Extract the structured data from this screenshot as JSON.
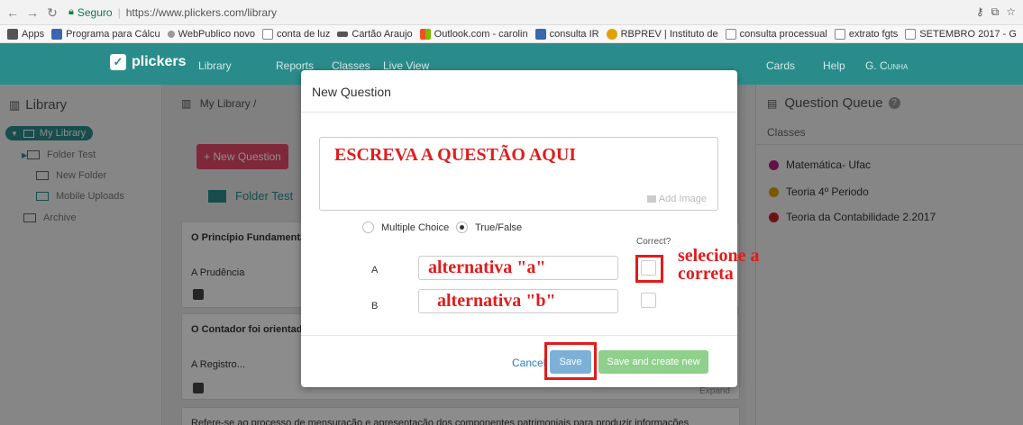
{
  "browser": {
    "secure_label": "Seguro",
    "url": "https://www.plickers.com/library",
    "bookmarks": [
      {
        "label": "Apps",
        "color": "#555555"
      },
      {
        "label": "Programa para Cálcu",
        "color": "#3a66b0"
      },
      {
        "label": "WebPublico novo",
        "color": "#999999"
      },
      {
        "label": "conta de luz",
        "color": "#888888"
      },
      {
        "label": "Cartão Araujo",
        "color": "#555555"
      },
      {
        "label": "Outlook.com - carolin",
        "color": "#f25022"
      },
      {
        "label": "consulta IR",
        "color": "#3a66b0"
      },
      {
        "label": "RBPREV | Instituto de",
        "color": "#e0a100"
      },
      {
        "label": "consulta processual",
        "color": "#888888"
      },
      {
        "label": "extrato fgts",
        "color": "#888888"
      },
      {
        "label": "SETEMBRO 2017 - G",
        "color": "#888888"
      }
    ]
  },
  "app": {
    "logo": "plickers",
    "nav": [
      "Library",
      "Reports",
      "Classes",
      "Live View"
    ],
    "nav_right": [
      "Cards",
      "Help",
      "G. Cunha"
    ]
  },
  "sidebar": {
    "title": "Library",
    "my_library": "My Library",
    "items": [
      "Folder Test",
      "New Folder",
      "Mobile Uploads",
      "Archive"
    ]
  },
  "center": {
    "breadcrumb": "My Library  /",
    "new_question": "+ New Question",
    "folder": "Folder Test",
    "cards": [
      {
        "title": "O Princípio Fundamenta autonomia patrimonial, e",
        "answer": "A  Prudência"
      },
      {
        "title": "O Contador foi orientado linearmente de um ativo",
        "answer": "A  Registro...",
        "expand": "Expand"
      }
    ],
    "footer_text": "Refere-se ao processo de mensuração e apresentação dos componentes patrimoniais para produzir informações"
  },
  "right": {
    "title": "Question Queue",
    "classes_label": "Classes",
    "classes": [
      {
        "name": "Matemática- Ufac",
        "color": "#b2227d"
      },
      {
        "name": "Teoria 4º Periodo",
        "color": "#e0a100"
      },
      {
        "name": "Teoria da Contabilidade 2.2017",
        "color": "#c9201f"
      }
    ]
  },
  "modal": {
    "title": "New Question",
    "question_text": "ESCREVA A QUESTÃO AQUI",
    "add_image": "Add Image",
    "type_options": [
      "Multiple Choice",
      "True/False"
    ],
    "selected_type": "True/False",
    "correct_label": "Correct?",
    "answers": [
      {
        "letter": "A",
        "text": "alternativa \"a\""
      },
      {
        "letter": "B",
        "text": "alternativa \"b\""
      }
    ],
    "annotation": "selecione a correta",
    "cancel": "Cancel",
    "save": "Save",
    "save_new": "Save and create new"
  }
}
